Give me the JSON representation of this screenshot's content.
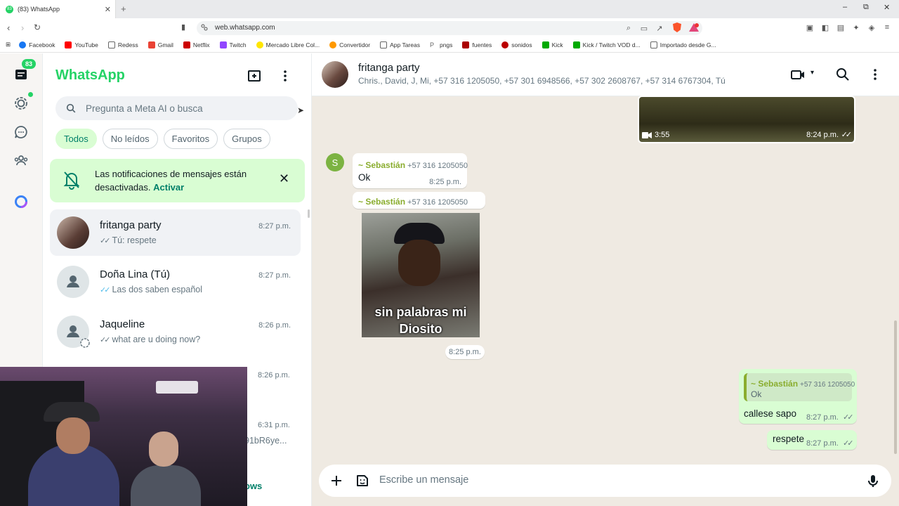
{
  "browser": {
    "tab_title": "(83) WhatsApp",
    "tab_badge": "83",
    "url": "web.whatsapp.com",
    "bookmarks": [
      "Facebook",
      "YouTube",
      "Redess",
      "Gmail",
      "Netflix",
      "Twitch",
      "Mercado Libre Col...",
      "Convertidor",
      "App Tareas",
      "pngs",
      "fuentes",
      "sonidos",
      "Kick",
      "Kick / Twitch VOD d...",
      "Importado desde G..."
    ]
  },
  "rail": {
    "unread_badge": "83"
  },
  "sidebar": {
    "brand": "WhatsApp",
    "search_placeholder": "Pregunta a Meta AI o busca",
    "filters": [
      "Todos",
      "No leídos",
      "Favoritos",
      "Grupos"
    ],
    "notice": {
      "text": "Las notificaciones de mensajes están desactivadas.",
      "action": "Activar"
    },
    "chats": [
      {
        "name": "fritanga party",
        "time": "8:27 p.m.",
        "preview": "Tú: respete"
      },
      {
        "name": "Doña Lina (Tú)",
        "time": "8:27 p.m.",
        "preview": "Las dos saben español"
      },
      {
        "name": "Jaqueline",
        "time": "8:26 p.m.",
        "preview": "what are u doing now?"
      },
      {
        "name": "",
        "time": "8:26 p.m.",
        "preview": ""
      },
      {
        "name": "",
        "time": "6:31 p.m.",
        "preview": "91bR6ye..."
      }
    ],
    "partial_link": "ows"
  },
  "chat": {
    "title": "fritanga party",
    "members": "Chris., David, J, Mi, +57 316 1205050, +57 301 6948566, +57 302 2608767, +57 314 6767304, Tú",
    "video_duration": "3:55",
    "video_time": "8:24 p.m.",
    "messages": [
      {
        "sender": "~ Sebastián",
        "number": "+57 316 1205050",
        "text": "Ok",
        "time": "8:25 p.m.",
        "avatar_letter": "S"
      },
      {
        "sender": "~ Sebastián",
        "number": "+57 316 1205050",
        "sticker_caption": "sin palabras mi Diosito",
        "time": "8:25 p.m."
      },
      {
        "quote_sender": "~ Sebastián",
        "quote_number": "+57 316 1205050",
        "quote_text": "Ok",
        "text": "callese sapo",
        "time": "8:27 p.m."
      },
      {
        "text": "respete",
        "time": "8:27 p.m."
      }
    ],
    "composer_placeholder": "Escribe un mensaje"
  },
  "colors": {
    "brand_green": "#25d366",
    "outgoing_bubble": "#d9fdd3",
    "chat_bg": "#efeae2",
    "sender_color": "#8aad2e"
  }
}
